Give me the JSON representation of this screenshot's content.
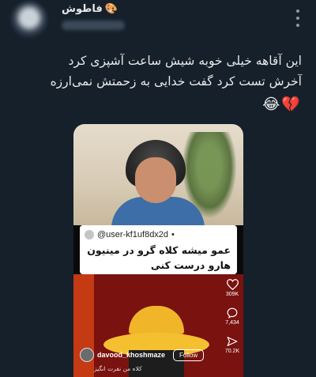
{
  "tweet": {
    "author_name": "فاطوش",
    "author_emoji": "🎨",
    "text_line1": "این آقاهه خیلی خوبه شیش ساعت آشپزی کرد",
    "text_line2": "آخرش تست کرد گفت خدایی به زحمتش نمی‌ارزه",
    "text_emojis": "😂💔"
  },
  "media": {
    "comment_username": "@user-kf1uf8dx2d",
    "comment_bullet": "•",
    "comment_text": "عمو میشه کلاه گرو در مینیون هارو درست کنی",
    "actions": {
      "likes": "309K",
      "comments": "7,434",
      "shares": "70.2K"
    },
    "creator_handle": "davood_khoshmaze",
    "follow_label": "Follow",
    "caption": "کلاه من نفرت انگیز"
  },
  "colors": {
    "background": "#15202b",
    "text": "#e7e9ea",
    "muted": "#8b98a5"
  }
}
